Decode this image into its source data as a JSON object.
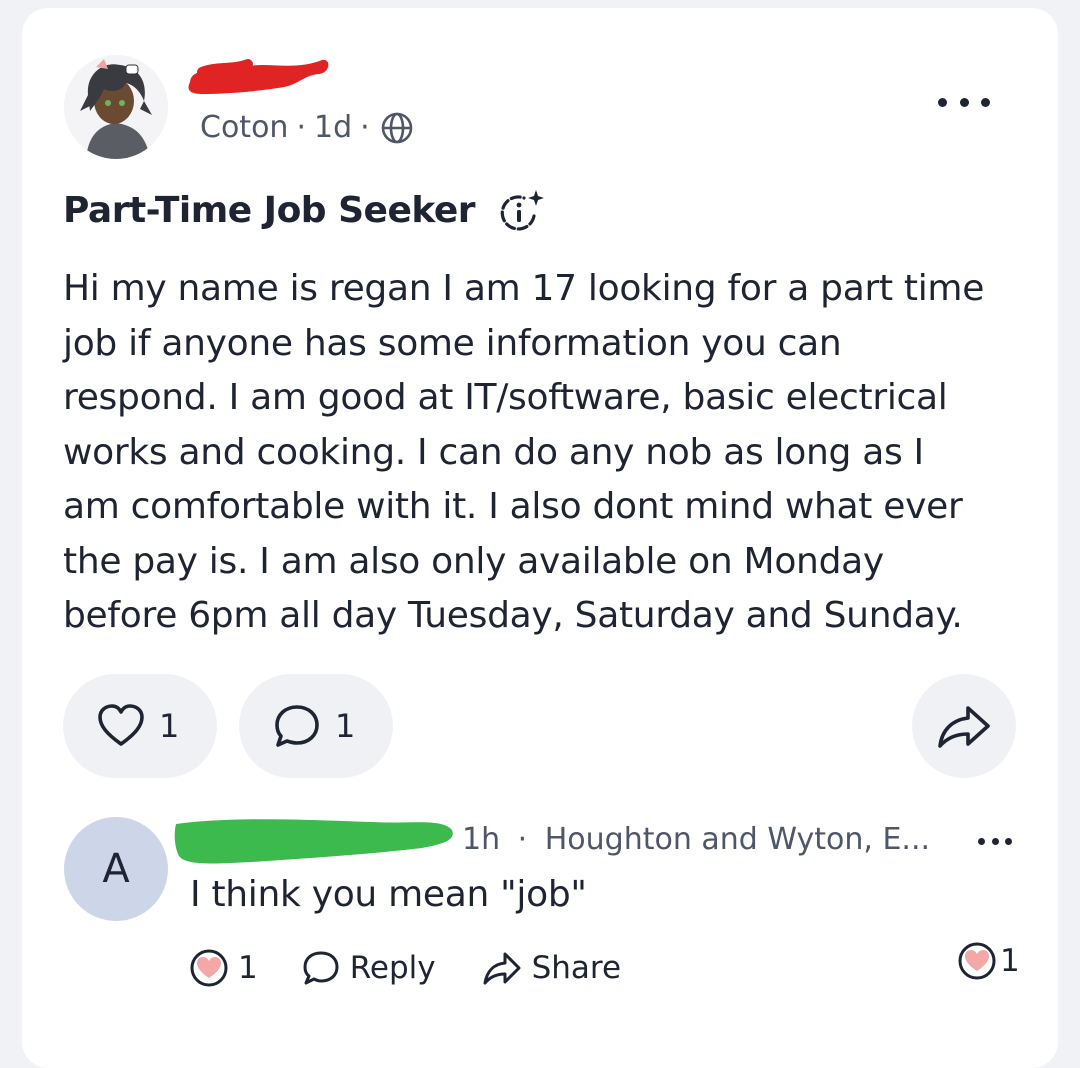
{
  "post": {
    "author_name": "",
    "community": "Coton",
    "age": "1d",
    "separator": "·",
    "visibility_icon": "globe-icon",
    "more_icon": "more-horizontal-icon",
    "title": "Part-Time Job Seeker",
    "ai_icon": "ai-info-sparkle-icon",
    "body_lines": [
      "Hi my name is regan I am 17 looking for a part time",
      "job if anyone has some information you can",
      "respond. I am good at IT/software,  basic electrical",
      "works and cooking.  I can do any  nob as long as I",
      "am comfortable with it. I also dont mind what  ever",
      "the pay is. I am also only available on Monday",
      "before 6pm all day Tuesday,  Saturday and Sunday."
    ],
    "likes": "1",
    "comments": "1",
    "share_icon": "share-arrow-icon"
  },
  "comment": {
    "avatar_letter": "A",
    "age": "1h",
    "separator": "·",
    "location": "Houghton and Wyton, E...",
    "text": "I think you mean \"job\"",
    "likes": "1",
    "reply_label": "Reply",
    "share_label": "Share",
    "reaction_count": "1"
  },
  "colors": {
    "background": "#f1f2f6",
    "card": "#ffffff",
    "text": "#1f2433",
    "muted": "#4f5668",
    "pill": "#f0f1f5",
    "heart_fill": "#f4a7a7",
    "avatar_bg": "#cdd5e8",
    "redaction_red": "#e02424",
    "redaction_green": "#3dba4e"
  }
}
